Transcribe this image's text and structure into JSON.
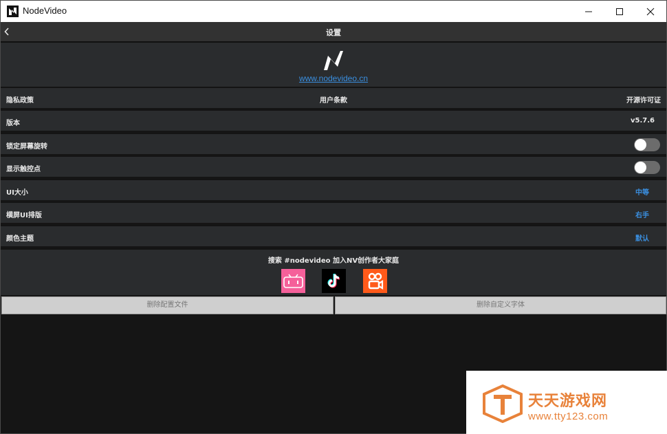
{
  "window": {
    "title": "NodeVideo"
  },
  "header": {
    "title": "设置"
  },
  "logo": {
    "link_text": "www.nodevideo.cn"
  },
  "links_row": {
    "privacy": "隐私政策",
    "terms": "用户条款",
    "license": "开源许可证"
  },
  "settings": {
    "version_label": "版本",
    "version_value": "v5.7.6",
    "lock_rotation_label": "锁定屏幕旋转",
    "lock_rotation_on": false,
    "show_touch_label": "显示触控点",
    "show_touch_on": false,
    "ui_size_label": "UI大小",
    "ui_size_value": "中等",
    "landscape_layout_label": "横屏UI排版",
    "landscape_layout_value": "右手",
    "color_theme_label": "颜色主题",
    "color_theme_value": "默认"
  },
  "social": {
    "text": "搜索 #nodevideo 加入NV创作者大家庭",
    "icons": [
      "bilibili-icon",
      "tiktok-icon",
      "kuaishou-icon"
    ]
  },
  "buttons": {
    "delete_config": "删除配置文件",
    "delete_font": "删除自定义字体"
  },
  "watermark": {
    "title": "天天游戏网",
    "url": "www.tty123.com"
  },
  "colors": {
    "accent_blue": "#3a8fe0",
    "panel": "#2a2c2e",
    "background": "#151515",
    "watermark_orange": "#e8823a"
  }
}
